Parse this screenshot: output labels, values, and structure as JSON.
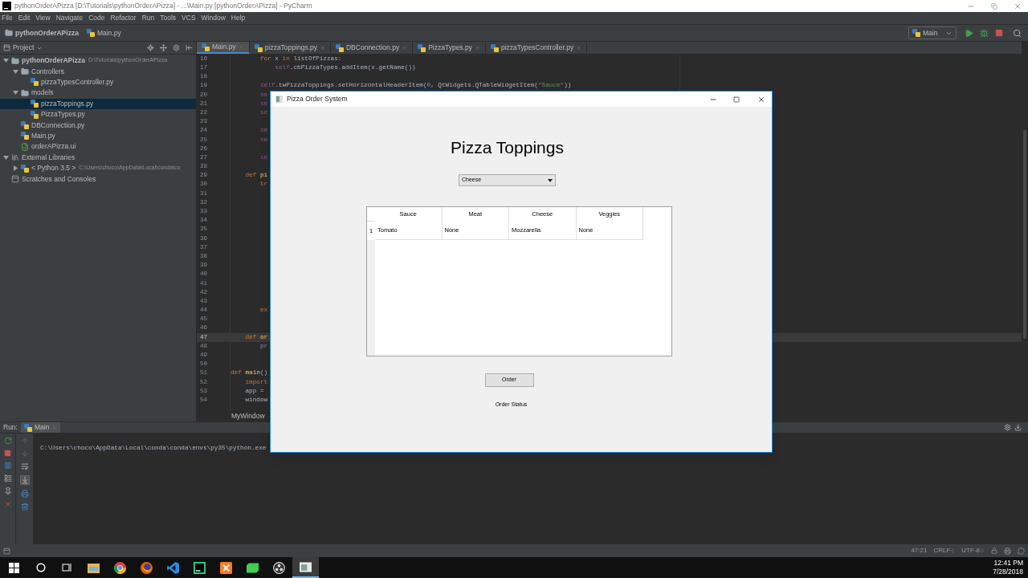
{
  "window": {
    "title": "pythonOrderAPizza [D:\\Tutorials\\pythonOrderAPizza] - ...\\Main.py [pythonOrderAPizza] - PyCharm"
  },
  "menu": [
    "File",
    "Edit",
    "View",
    "Navigate",
    "Code",
    "Refactor",
    "Run",
    "Tools",
    "VCS",
    "Window",
    "Help"
  ],
  "navbar": {
    "breadcrumbs": [
      {
        "label": "pythonOrderAPizza",
        "kind": "folder"
      },
      {
        "label": "Main.py",
        "kind": "python"
      }
    ],
    "run_config": "Main"
  },
  "project": {
    "title": "Project",
    "tree": [
      {
        "label": "pythonOrderAPizza",
        "path": "D:\\Tutorials\\pythonOrderAPizza",
        "kind": "project",
        "expanded": true,
        "selected": false,
        "children": [
          {
            "label": "Controllers",
            "kind": "folder",
            "expanded": true,
            "selected": false,
            "children": [
              {
                "label": "pizzaTypesController.py",
                "kind": "python",
                "selected": false
              }
            ]
          },
          {
            "label": "models",
            "kind": "folder",
            "expanded": true,
            "selected": false,
            "children": [
              {
                "label": "pizzaToppings.py",
                "kind": "python",
                "selected": true
              },
              {
                "label": "PizzaTypes.py",
                "kind": "python",
                "selected": false
              }
            ]
          },
          {
            "label": "DBConnection.py",
            "kind": "python",
            "selected": false
          },
          {
            "label": "Main.py",
            "kind": "python",
            "selected": false
          },
          {
            "label": "orderAPizza.ui",
            "kind": "ui",
            "selected": false
          }
        ]
      },
      {
        "label": "External Libraries",
        "kind": "library",
        "expanded": true,
        "selected": false,
        "children": [
          {
            "label": "< Python 3.5 >",
            "path": "C:\\Users\\choco\\AppData\\Local\\conda\\co",
            "kind": "sdk",
            "expanded": false,
            "selected": false
          }
        ]
      },
      {
        "label": "Scratches and Consoles",
        "kind": "scratches",
        "selected": false
      }
    ]
  },
  "editor_tabs": [
    {
      "label": "Main.py",
      "selected": true
    },
    {
      "label": "pizzaToppings.py",
      "selected": false
    },
    {
      "label": "DBConnection.py",
      "selected": false
    },
    {
      "label": "PizzaTypes.py",
      "selected": false
    },
    {
      "label": "pizzaTypesController.py",
      "selected": false
    }
  ],
  "editor": {
    "breadcrumb": "MyWindow",
    "lines": [
      {
        "number": "16",
        "current": false,
        "code": [
          {
            "text": "        for",
            "kind": "keyword"
          },
          {
            "text": " x ",
            "kind": "plain"
          },
          {
            "text": "in",
            "kind": "keyword"
          },
          {
            "text": " listOfPizzas:",
            "kind": "plain"
          }
        ]
      },
      {
        "number": "17",
        "current": false,
        "code": [
          {
            "text": "            self",
            "kind": "self"
          },
          {
            "text": ".cbPizzaTypes.addItem(x.getName())",
            "kind": "plain"
          }
        ]
      },
      {
        "number": "18",
        "current": false
      },
      {
        "number": "19",
        "current": false,
        "code": [
          {
            "text": "        self",
            "kind": "self"
          },
          {
            "text": ".twPizzaToppings.setHorizontalHeaderItem(",
            "kind": "plain"
          },
          {
            "text": "0",
            "kind": "number"
          },
          {
            "text": ", QtWidgets.QTableWidgetItem(",
            "kind": "plain"
          },
          {
            "text": "\"Sauce\"",
            "kind": "string"
          },
          {
            "text": "))",
            "kind": "plain"
          }
        ]
      },
      {
        "number": "20",
        "current": false,
        "code": [
          {
            "text": "        se",
            "kind": "self"
          }
        ]
      },
      {
        "number": "21",
        "current": false,
        "code": [
          {
            "text": "        se",
            "kind": "self"
          }
        ]
      },
      {
        "number": "22",
        "current": false,
        "code": [
          {
            "text": "        se",
            "kind": "self"
          }
        ]
      },
      {
        "number": "23",
        "current": false
      },
      {
        "number": "24",
        "current": false,
        "code": [
          {
            "text": "        se",
            "kind": "self"
          }
        ]
      },
      {
        "number": "25",
        "current": false,
        "code": [
          {
            "text": "        se",
            "kind": "self"
          }
        ]
      },
      {
        "number": "26",
        "current": false
      },
      {
        "number": "27",
        "current": false,
        "code": [
          {
            "text": "        se",
            "kind": "self"
          }
        ]
      },
      {
        "number": "28",
        "current": false
      },
      {
        "number": "29",
        "current": false,
        "code": [
          {
            "text": "    def",
            "kind": "keyword"
          },
          {
            "text": " pi",
            "kind": "function"
          }
        ]
      },
      {
        "number": "30",
        "current": false,
        "code": [
          {
            "text": "        tr",
            "kind": "keyword"
          }
        ]
      },
      {
        "number": "31",
        "current": false
      },
      {
        "number": "32",
        "current": false
      },
      {
        "number": "33",
        "current": false
      },
      {
        "number": "34",
        "current": false
      },
      {
        "number": "35",
        "current": false
      },
      {
        "number": "36",
        "current": false
      },
      {
        "number": "37",
        "current": false
      },
      {
        "number": "38",
        "current": false
      },
      {
        "number": "39",
        "current": false
      },
      {
        "number": "40",
        "current": false
      },
      {
        "number": "41",
        "current": false
      },
      {
        "number": "42",
        "current": false
      },
      {
        "number": "43",
        "current": false
      },
      {
        "number": "44",
        "current": false,
        "code": [
          {
            "text": "        ex",
            "kind": "keyword"
          }
        ]
      },
      {
        "number": "45",
        "current": false
      },
      {
        "number": "46",
        "current": false
      },
      {
        "number": "47",
        "current": true,
        "code": [
          {
            "text": "    def",
            "kind": "keyword"
          },
          {
            "text": " or",
            "kind": "function"
          }
        ]
      },
      {
        "number": "48",
        "current": false,
        "code": [
          {
            "text": "        pr",
            "kind": "builtin"
          }
        ]
      },
      {
        "number": "49",
        "current": false
      },
      {
        "number": "50",
        "current": false
      },
      {
        "number": "51",
        "current": false,
        "code": [
          {
            "text": "def",
            "kind": "keyword"
          },
          {
            "text": " main",
            "kind": "function"
          },
          {
            "text": "()",
            "kind": "plain"
          }
        ]
      },
      {
        "number": "52",
        "current": false,
        "code": [
          {
            "text": "    import",
            "kind": "keyword"
          }
        ]
      },
      {
        "number": "53",
        "current": false,
        "code": [
          {
            "text": "    app =",
            "kind": "plain"
          }
        ]
      },
      {
        "number": "54",
        "current": false,
        "code": [
          {
            "text": "    window",
            "kind": "plain"
          }
        ]
      }
    ]
  },
  "run": {
    "label": "Run:",
    "tab": "Main",
    "output": "C:\\Users\\choco\\AppData\\Local\\conda\\conda\\envs\\py35\\python.exe"
  },
  "status_bar": {
    "position": "47:21",
    "line_separator": "CRLF",
    "encoding": "UTF-8"
  },
  "taskbar": {
    "items": [
      {
        "kind": "start",
        "selected": false
      },
      {
        "kind": "search",
        "selected": false
      },
      {
        "kind": "taskview",
        "selected": false
      },
      {
        "kind": "explorer",
        "selected": false
      },
      {
        "kind": "chrome",
        "selected": false
      },
      {
        "kind": "firefox",
        "selected": false
      },
      {
        "kind": "vscode",
        "selected": false
      },
      {
        "kind": "pycharm",
        "selected": false
      },
      {
        "kind": "xampp",
        "selected": false
      },
      {
        "kind": "qt",
        "selected": false
      },
      {
        "kind": "obs",
        "selected": false
      },
      {
        "kind": "qtapp",
        "selected": true
      }
    ],
    "time": "12:41 PM",
    "date": "7/28/2018"
  },
  "dialog": {
    "title": "Pizza Order System",
    "heading": "Pizza Toppings",
    "combo": {
      "value": "Cheese"
    },
    "table": {
      "columns": [
        "Sauce",
        "Meat",
        "Cheese",
        "Veggies"
      ],
      "rows": [
        {
          "header": "1",
          "cells": [
            "Tomato",
            "None",
            "Mozzarella",
            "None"
          ]
        }
      ]
    },
    "button": "Order",
    "status": "Order Status"
  }
}
